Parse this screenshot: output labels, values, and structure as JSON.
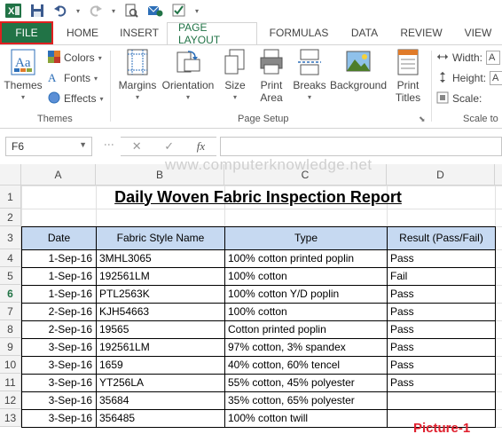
{
  "qat": {
    "icons": [
      "excel-logo-icon",
      "save-icon",
      "undo-icon",
      "redo-icon",
      "print-preview-icon",
      "email-icon",
      "checkmark-box-icon",
      "customize-qat-icon"
    ]
  },
  "tabs": [
    {
      "label": "FILE"
    },
    {
      "label": "HOME"
    },
    {
      "label": "INSERT"
    },
    {
      "label": "PAGE LAYOUT"
    },
    {
      "label": "FORMULAS"
    },
    {
      "label": "DATA"
    },
    {
      "label": "REVIEW"
    },
    {
      "label": "VIEW"
    }
  ],
  "ribbon": {
    "themes": {
      "themes_label": "Themes",
      "colors_label": "Colors",
      "fonts_label": "Fonts",
      "effects_label": "Effects",
      "group_label": "Themes"
    },
    "page_setup": {
      "margins": "Margins",
      "orientation": "Orientation",
      "size": "Size",
      "print_area": "Print\nArea",
      "breaks": "Breaks",
      "background": "Background",
      "print_titles": "Print\nTitles",
      "group_label": "Page Setup"
    },
    "scale": {
      "width_label": "Width:",
      "height_label": "Height:",
      "scale_label": "Scale:",
      "group_label": "Scale to",
      "width_value": "A",
      "height_value": "A"
    }
  },
  "formula_bar": {
    "name_box": "F6",
    "cancel": "✕",
    "enter": "✓",
    "fx": "fx",
    "content": ""
  },
  "watermark": "www.computerknowledge.net",
  "columns": [
    "A",
    "B",
    "C",
    "D"
  ],
  "rows": [
    "1",
    "2",
    "3",
    "4",
    "5",
    "6",
    "7",
    "8",
    "9",
    "10",
    "11",
    "12",
    "13"
  ],
  "selected_row": "6",
  "sheet": {
    "title": "Daily Woven Fabric Inspection Report",
    "headers": [
      "Date",
      "Fabric Style Name",
      "Type",
      "Result (Pass/Fail)"
    ],
    "data": [
      [
        "1-Sep-16",
        "3MHL3065",
        "100% cotton printed poplin",
        "Pass"
      ],
      [
        "1-Sep-16",
        "192561LM",
        "100% cotton",
        "Fail"
      ],
      [
        "1-Sep-16",
        "PTL2563K",
        "100% cotton Y/D poplin",
        "Pass"
      ],
      [
        "2-Sep-16",
        "KJH54663",
        "100% cotton",
        "Pass"
      ],
      [
        "2-Sep-16",
        "19565",
        "Cotton printed poplin",
        "Pass"
      ],
      [
        "3-Sep-16",
        "192561LM",
        "97% cotton, 3% spandex",
        "Pass"
      ],
      [
        "3-Sep-16",
        "1659",
        "40% cotton, 60% tencel",
        "Pass"
      ],
      [
        "3-Sep-16",
        "YT256LA",
        "55% cotton, 45% polyester",
        "Pass"
      ],
      [
        "3-Sep-16",
        "35684",
        "35% cotton, 65% polyester",
        ""
      ],
      [
        "3-Sep-16",
        "356485",
        "100% cotton twill",
        ""
      ]
    ]
  },
  "caption": "Picture-1",
  "colors": {
    "excel_green": "#217346",
    "header_fill": "#c6d9f1",
    "file_border": "#e02020",
    "caption": "#e0202e"
  }
}
